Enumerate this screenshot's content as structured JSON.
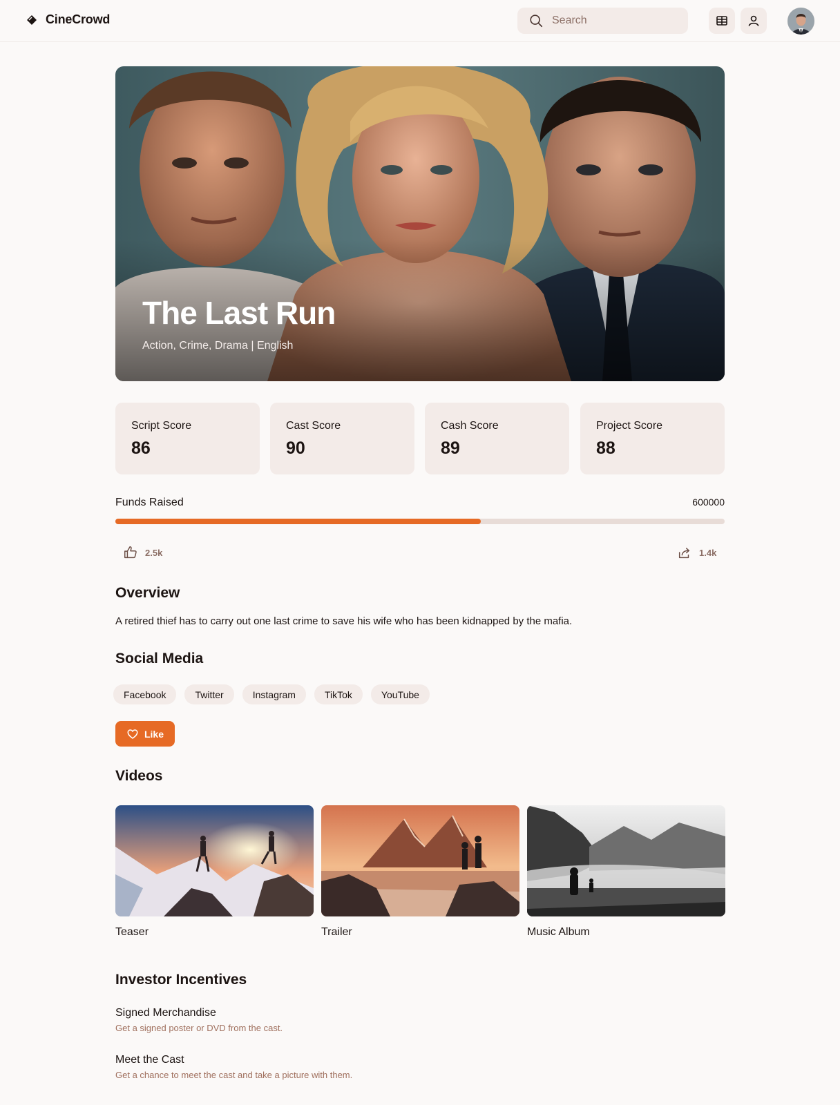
{
  "app": {
    "name": "CineCrowd"
  },
  "header": {
    "search_placeholder": "Search",
    "icons": [
      "film-icon",
      "user-icon"
    ]
  },
  "hero": {
    "title": "The Last Run",
    "subtitle": "Action, Crime, Drama | English"
  },
  "scores": [
    {
      "label": "Script Score",
      "value": "86"
    },
    {
      "label": "Cast Score",
      "value": "90"
    },
    {
      "label": "Cash Score",
      "value": "89"
    },
    {
      "label": "Project Score",
      "value": "88"
    }
  ],
  "funds": {
    "label": "Funds Raised",
    "amount": "600000",
    "progress_fraction": 0.6
  },
  "stats": {
    "likes": "2.5k",
    "shares": "1.4k"
  },
  "overview": {
    "heading": "Overview",
    "text": "A retired thief has to carry out one last crime to save his wife who has been kidnapped by the mafia."
  },
  "social": {
    "heading": "Social Media",
    "chips": [
      "Facebook",
      "Twitter",
      "Instagram",
      "TikTok",
      "YouTube"
    ]
  },
  "like_button": {
    "label": "Like"
  },
  "videos": {
    "heading": "Videos",
    "items": [
      {
        "caption": "Teaser"
      },
      {
        "caption": "Trailer"
      },
      {
        "caption": "Music Album"
      }
    ]
  },
  "incentives": {
    "heading": "Investor Incentives",
    "items": [
      {
        "title": "Signed Merchandise",
        "desc": "Get a signed poster or DVD from the cast."
      },
      {
        "title": "Meet the Cast",
        "desc": "Get a chance to meet the cast and take a picture with them."
      }
    ]
  },
  "colors": {
    "accent": "#e66a25",
    "chip_bg": "#f3ebe8",
    "muted_text": "#8c6f66"
  }
}
